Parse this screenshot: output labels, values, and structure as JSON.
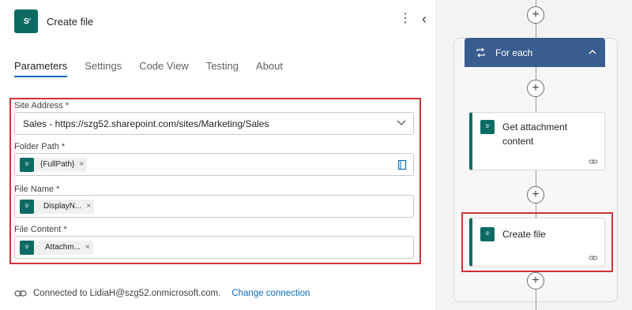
{
  "header": {
    "title": "Create file",
    "icon": "sharepoint-icon"
  },
  "tabs": [
    {
      "label": "Parameters",
      "active": true
    },
    {
      "label": "Settings",
      "active": false
    },
    {
      "label": "Code View",
      "active": false
    },
    {
      "label": "Testing",
      "active": false
    },
    {
      "label": "About",
      "active": false
    }
  ],
  "fields": {
    "site_address": {
      "label": "Site Address *",
      "value": "Sales - https://szg52.sharepoint.com/sites/Marketing/Sales"
    },
    "folder_path": {
      "label": "Folder Path *",
      "token": "{FullPath}"
    },
    "file_name": {
      "label": "File Name *",
      "token": "DisplayN..."
    },
    "file_content": {
      "label": "File Content *",
      "token": "Attachm..."
    }
  },
  "footer": {
    "connected_text": "Connected to LidiaH@szg52.onmicrosoft.com.",
    "change_label": "Change connection"
  },
  "canvas": {
    "foreach_label": "For each",
    "cards": [
      {
        "title_line1": "Get attachment",
        "title_line2": "content"
      },
      {
        "title_line1": "Create file"
      }
    ]
  },
  "colors": {
    "accent": "#0f6cbd",
    "sharepoint": "#0b6b64",
    "highlight": "#d13438",
    "foreach": "#3a5d8f"
  }
}
